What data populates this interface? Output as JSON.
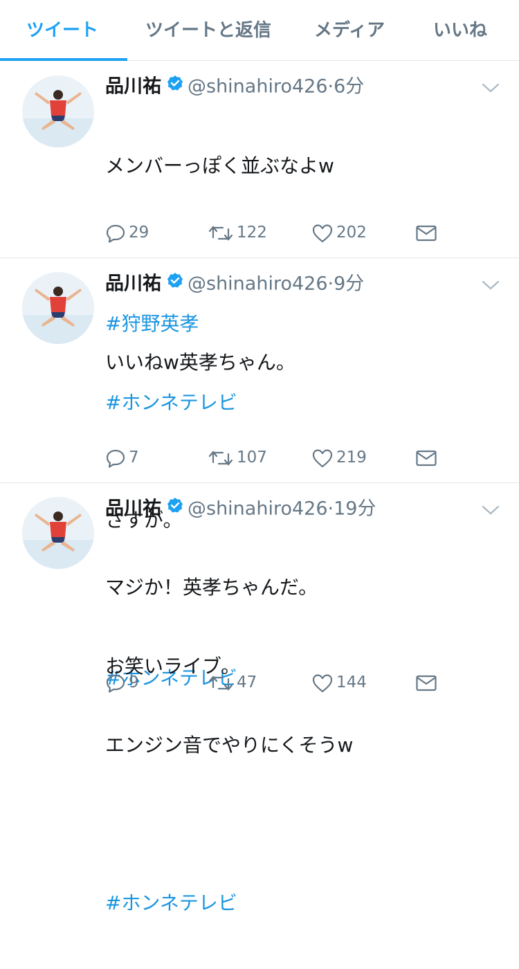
{
  "tabs": [
    {
      "label": "ツイート"
    },
    {
      "label": "ツイートと返信"
    },
    {
      "label": "メディア"
    },
    {
      "label": "いいね"
    }
  ],
  "tweets": [
    {
      "name": "品川祐",
      "handle": "@shinahiro426",
      "time": "·6分",
      "lines": [
        "メンバーっぽく並ぶなよw",
        ""
      ],
      "hashtags": [
        "#狩野英孝",
        "#ホンネテレビ"
      ],
      "replies": "29",
      "retweets": "122",
      "likes": "202"
    },
    {
      "name": "品川祐",
      "handle": "@shinahiro426",
      "time": "·9分",
      "lines": [
        "いいねw英孝ちゃん。",
        "",
        "さすが。",
        ""
      ],
      "hashtags": [
        "#ホンネテレビ"
      ],
      "replies": "7",
      "retweets": "107",
      "likes": "219"
    },
    {
      "name": "品川祐",
      "handle": "@shinahiro426",
      "time": "·19分",
      "lines": [
        "マジか！英孝ちゃんだ。",
        "お笑いライブ。",
        "エンジン音でやりにくそうw",
        ""
      ],
      "hashtags": [
        "#ホンネテレビ"
      ],
      "replies": "9",
      "retweets": "47",
      "likes": "144"
    }
  ],
  "colors": {
    "accent": "#1da1f2",
    "hashtag": "#1b95e0",
    "muted": "#657786",
    "divider": "#e1e8ed"
  }
}
